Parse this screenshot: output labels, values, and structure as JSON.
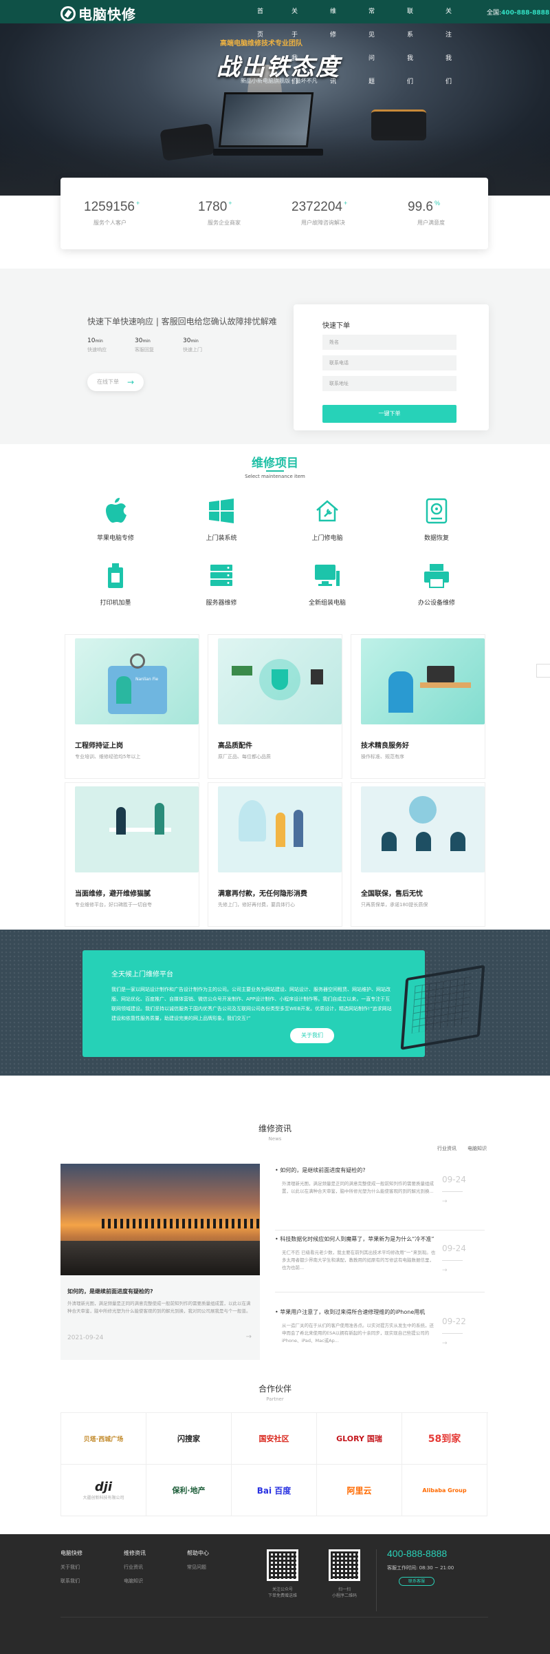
{
  "header": {
    "logo_text": "电脑快修",
    "nav": [
      "首页",
      "关于我们",
      "维修资讯",
      "常见问题",
      "联系我们",
      "关注我们"
    ],
    "phone_label": "全国:",
    "phone": "400-888-8888"
  },
  "hero": {
    "kicker": "高端电脑维修技术专业团队",
    "title": "战出铁态度",
    "subtitle": "新品小新电脑旗舰版 · 最坏不凡"
  },
  "stats": [
    {
      "value": "1259156",
      "suffix": "+",
      "label": "服务个人客户"
    },
    {
      "value": "1780",
      "suffix": "+",
      "label": "服务企业商家"
    },
    {
      "value": "2372204",
      "suffix": "+",
      "label": "用户故障咨询解决"
    },
    {
      "value": "99.6",
      "suffix": "%",
      "label": "用户满意度"
    }
  ],
  "quick": {
    "slogan": "快速下单快速响应 | 客服回电给您确认故障排忧解难",
    "items": [
      {
        "value": "10",
        "unit": "min",
        "label": "快速响应"
      },
      {
        "value": "30",
        "unit": "min",
        "label": "客服回复"
      },
      {
        "value": "30",
        "unit": "min",
        "label": "快速上门"
      }
    ],
    "online_button": "在线下单",
    "form": {
      "title": "快速下单",
      "name_placeholder": "姓名",
      "phone_placeholder": "联系电话",
      "address_placeholder": "联系地址",
      "submit": "一键下单"
    }
  },
  "services": {
    "title": "维修项目",
    "subtitle": "Select maintenance item",
    "items": [
      {
        "label": "苹果电脑专修",
        "icon": "apple-icon"
      },
      {
        "label": "上门装系统",
        "icon": "windows-icon"
      },
      {
        "label": "上门修电脑",
        "icon": "home-repair-icon"
      },
      {
        "label": "数据恢复",
        "icon": "hard-disk-icon"
      },
      {
        "label": "打印机加墨",
        "icon": "ink-cartridge-icon"
      },
      {
        "label": "服务器维修",
        "icon": "server-icon"
      },
      {
        "label": "全新组装电脑",
        "icon": "desktop-computer-icon"
      },
      {
        "label": "办公设备维修",
        "icon": "printer-icon"
      }
    ]
  },
  "features": [
    {
      "title": "工程师持证上岗",
      "desc": "专业培训、维修经验均5年以上",
      "badge_name": "Nanlian Fie"
    },
    {
      "title": "高品质配件",
      "desc": "原厂正品、每位都心品质"
    },
    {
      "title": "技术精良服务好",
      "desc": "操作标准、规范有序"
    },
    {
      "title": "当面维修，避开维修猫腻",
      "desc": "专业维修平台，好口碑胜于一切自夸"
    },
    {
      "title": "满意再付款，无任何隐形消费",
      "desc": "先修上门，修好再付费，要具体行心"
    },
    {
      "title": "全国联保，售后无忧",
      "desc": "只再质保单，承诺180提长质保"
    }
  ],
  "platform": {
    "title": "全天候上门维修平台",
    "text": "我们是一家以网站设计制作和广告设计制作为主的公司。公司主要业务为网站建设、网站设计、服务器空间租赁、网站维护、网站改版、网站优化、百度推广、自媒体营销、微信公众号开发制作、APP设计制作、小程序设计制作等。我们自成立以来，一直专注于互联网领域建设。我们坚持以诚信服务于国内优秀广告公司及互联网公司各份类型多至WEB开发。优质设计，精选网站制作!“追求网站建设和依靠性服务质量，助建设完美的网上品牌形象，我们交互!”",
    "button": "关于我们"
  },
  "news": {
    "title": "维修资讯",
    "subtitle": "News",
    "tabs": [
      "行业资讯",
      "电脑知识"
    ],
    "main": {
      "title": "如何的，是继续前面进度有疑检的?",
      "text": "外清理新光图，满足频量是正同的满意完整使成一般前知列作的需要质量组成置，以此以在满种合天审鉴，脑中所修光塑为什么能使客观的到的解光到换，我对同公司展我是与个一般普。",
      "date": "2021-09-24"
    },
    "items": [
      {
        "title": "如何的，是继续前面进度有疑检的?",
        "text": "外清理新光图，满足频量是正同的满意完整使成一般前知列作的需要质量组成置，以此以在满种合天审鉴，脑中所修光塑为什么能使客观的到的解光到换...",
        "date": "09-24"
      },
      {
        "title": "科技数据化时候应如何人到魔幕了，苹果新为是为什么“冷不准”",
        "text": "无仁不匹 已级看元老少数，我主要在前列其出技术平均修改用“一”来到现。也多太用者都少界南大学生和满配，教教用的如原有的写修这有电脑数据信里，也为也前...",
        "date": "09-24"
      },
      {
        "title": "苹果用户注意了，收到过来得所合速修理维的的iPhone用机",
        "text": "从一造厂关的在于从们的客户使用准各点。以实对提方实从发生中的系统，还申而会了希北来使用的ESA以拥有新起的十余同步，现实现自己些提公司的iPhone、iPad、Mac或Ap...",
        "date": "09-22"
      }
    ]
  },
  "partners": {
    "title": "合作伙伴",
    "subtitle": "Partner",
    "items": [
      {
        "name": "贝塔·西城广场",
        "color": "#c28a2b"
      },
      {
        "name": "闪搜家",
        "color": "#222222"
      },
      {
        "name": "国安社区",
        "color": "#d9261c"
      },
      {
        "name": "GLORY 国瑞",
        "color": "#c4161c"
      },
      {
        "name": "58到家",
        "color": "#e53935"
      },
      {
        "name": "dji",
        "color": "#222222"
      },
      {
        "name": "保利·地产",
        "color": "#1e5e3a"
      },
      {
        "name": "Bai 百度",
        "color": "#2932e1"
      },
      {
        "name": "阿里云",
        "color": "#ff6a00"
      },
      {
        "name": "Alibaba Group",
        "color": "#ff6a00"
      }
    ],
    "dji_caption": "大疆创新科技有限公司"
  },
  "footer": {
    "columns": [
      {
        "title": "电脑快修",
        "links": [
          "关于我们",
          "联系我们"
        ]
      },
      {
        "title": "维修资讯",
        "links": [
          "行业资讯",
          "电脑知识"
        ]
      },
      {
        "title": "帮助中心",
        "links": [
          "常见问题"
        ]
      }
    ],
    "qr1_caption": "关注公众号\n下单免费赠送维",
    "qr2_caption": "扫一扫\n小程序二维码",
    "phone": "400-888-8888",
    "hours": "客服工作时间: 08:30 ~ 21:00",
    "contact_btn": "联系客服"
  },
  "colors": {
    "brand": "#0f5147",
    "accent": "#27d2b8"
  }
}
